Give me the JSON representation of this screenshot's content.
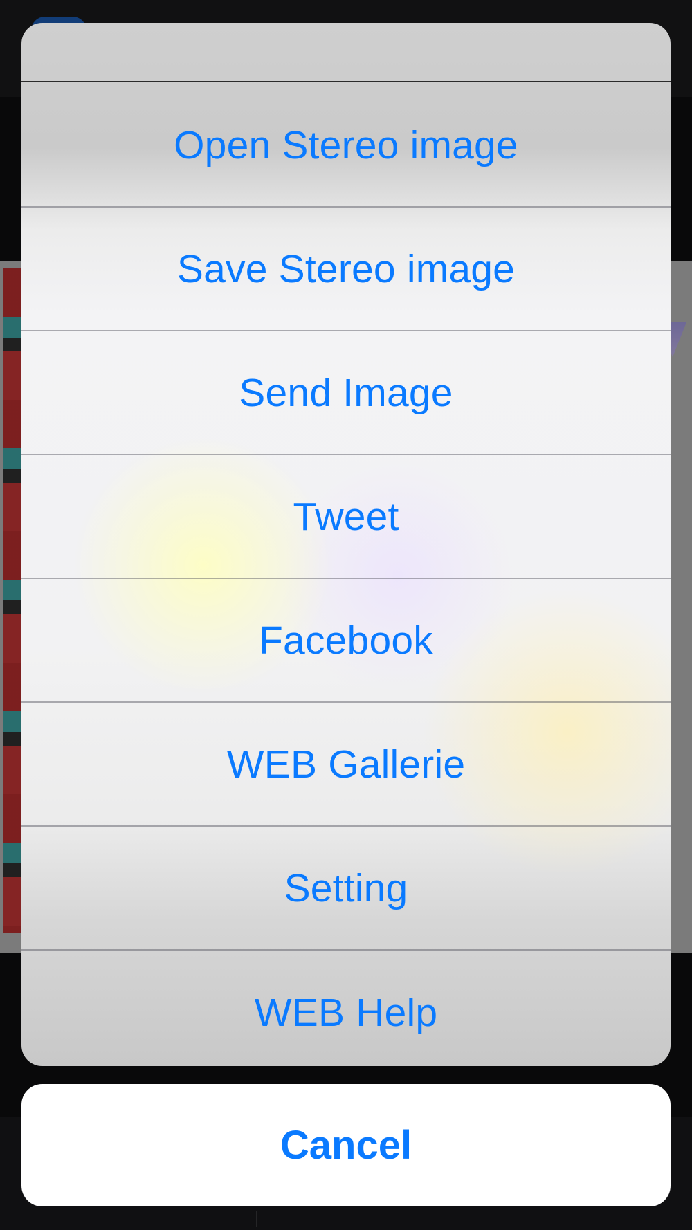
{
  "action_sheet": {
    "items": [
      {
        "label": "Open Stereo image"
      },
      {
        "label": "Save Stereo image"
      },
      {
        "label": "Send Image"
      },
      {
        "label": "Tweet"
      },
      {
        "label": "Facebook"
      },
      {
        "label": "WEB Gallerie"
      },
      {
        "label": "Setting"
      },
      {
        "label": "WEB Help"
      }
    ],
    "cancel_label": "Cancel"
  },
  "colors": {
    "accent": "#0a7aff",
    "sheet_background": "#f2f2f3",
    "cancel_background": "#ffffff"
  }
}
